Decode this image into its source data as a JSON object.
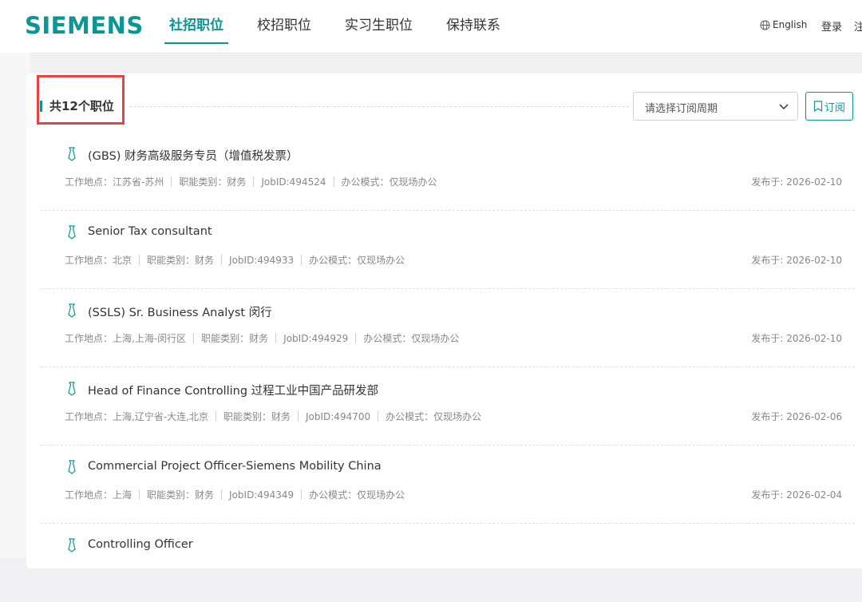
{
  "header": {
    "logo": "SIEMENS",
    "nav": [
      "社招职位",
      "校招职位",
      "实习生职位",
      "保持联系"
    ],
    "active_nav": "社招职位",
    "language": "English",
    "login": "登录",
    "register": "注"
  },
  "listing": {
    "count_label": "共12个职位",
    "select_placeholder": "请选择订阅周期",
    "subscribe_label": "订阅",
    "jobs": [
      {
        "title": "(GBS) 财务高级服务专员（增值税发票）",
        "meta": [
          "工作地点：江苏省-苏州",
          "职能类别：财务",
          "JobID:494524",
          "办公模式：仅现场办公"
        ],
        "date": "发布于: 2026-02-10"
      },
      {
        "title": "Senior Tax consultant",
        "meta": [
          "工作地点：北京",
          "职能类别：财务",
          "JobID:494933",
          "办公模式：仅现场办公"
        ],
        "date": "发布于: 2026-02-10"
      },
      {
        "title": "(SSLS) Sr. Business Analyst 闵行",
        "meta": [
          "工作地点：上海,上海-闵行区",
          "职能类别：财务",
          "JobID:494929",
          "办公模式：仅现场办公"
        ],
        "date": "发布于: 2026-02-10"
      },
      {
        "title": "Head of Finance Controlling 过程工业中国产品研发部",
        "meta": [
          "工作地点：上海,辽宁省-大连,北京",
          "职能类别：财务",
          "JobID:494700",
          "办公模式：仅现场办公"
        ],
        "date": "发布于: 2026-02-06"
      },
      {
        "title": "Commercial Project Officer-Siemens Mobility China",
        "meta": [
          "工作地点：上海",
          "职能类别：财务",
          "JobID:494349",
          "办公模式：仅现场办公"
        ],
        "date": "发布于: 2026-02-04"
      },
      {
        "title": "Controlling Officer",
        "meta": [],
        "date": ""
      }
    ]
  },
  "colors": {
    "brand": "#0b9696",
    "highlight": "#e74343"
  }
}
